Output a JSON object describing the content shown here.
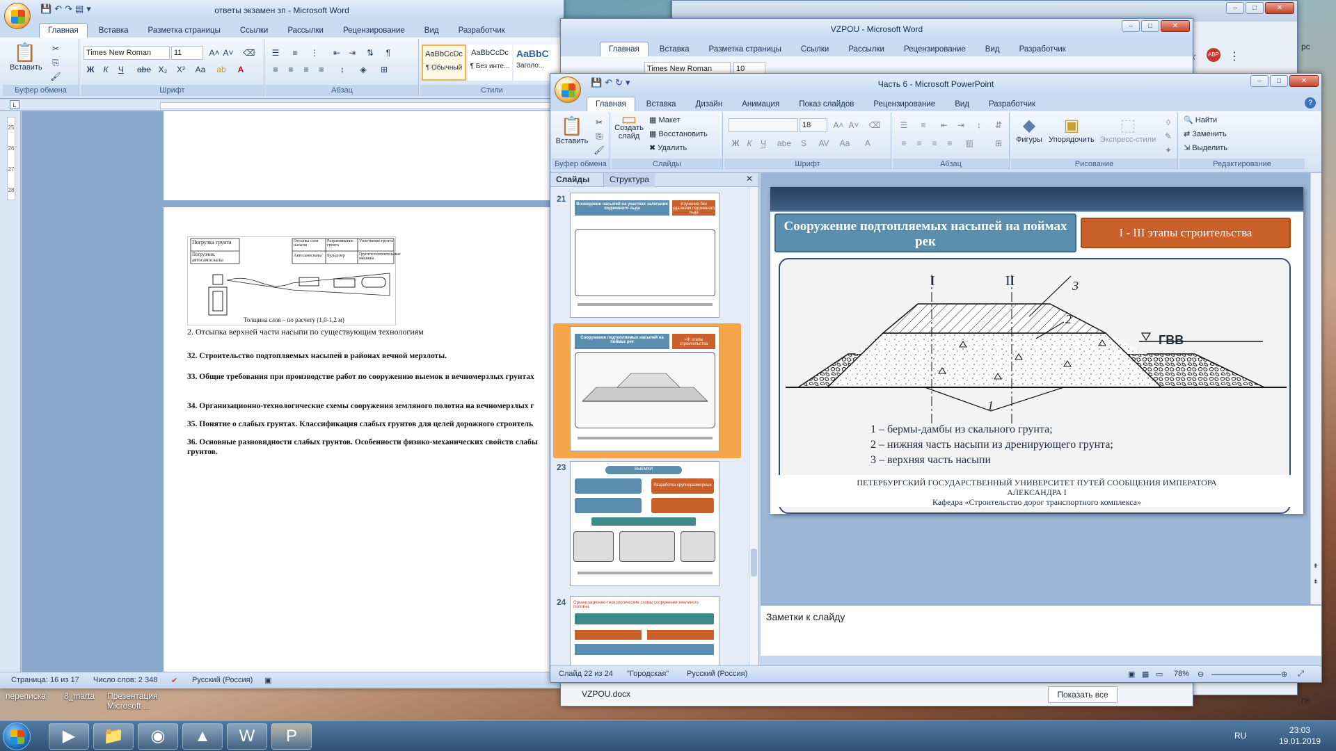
{
  "desktop": {
    "items": [
      {
        "label": "переписка"
      },
      {
        "label": "8_marta"
      },
      {
        "label": "Презентация"
      },
      {
        "label": "Microsoft ..."
      }
    ],
    "partial_texts": [
      "рс",
      "ne"
    ]
  },
  "word_main": {
    "title": "ответы экзамен зп - Microsoft Word",
    "tabs": [
      "Главная",
      "Вставка",
      "Разметка страницы",
      "Ссылки",
      "Рассылки",
      "Рецензирование",
      "Вид",
      "Разработчик"
    ],
    "groups": {
      "clipboard": "Буфер обмена",
      "font": "Шрифт",
      "paragraph": "Абзац",
      "styles": "Стили"
    },
    "paste_label": "Вставить",
    "font_name": "Times New Roman",
    "font_size": "11",
    "format_buttons": [
      "Ж",
      "К",
      "Ч",
      "abe",
      "X₂",
      "X²",
      "Aa"
    ],
    "styles": [
      {
        "preview": "AaBbCcDc",
        "name": "¶ Обычный"
      },
      {
        "preview": "AaBbCcDc",
        "name": "¶ Без инте..."
      },
      {
        "preview": "AaBbC",
        "name": "Заголо..."
      }
    ],
    "ruler_marks": [
      "25",
      "26",
      "27",
      "28"
    ],
    "doc": {
      "figure": {
        "left_table": [
          [
            "Погрузка",
            "грунта"
          ],
          [
            "Погрузчик,",
            "автосамосвалы"
          ]
        ],
        "right_table": {
          "headers": [
            "Отсыпка слоя насыпи",
            "Разравнивание грунта",
            "Уплотнение грунта"
          ],
          "values": [
            "Автосамосвалы",
            "Бульдозер",
            "Грунтоуплотнительные машины"
          ]
        },
        "caption": "Толщина слоя – по расчету (1,0-1,2 м)"
      },
      "lines": [
        "2. Отсыпка верхней части насыпи по существующим технологиям",
        "32. Строительство подтопляемых насыпей в районах вечной мерзлоты.",
        "33. Общие требования при производстве работ по сооружению выемок в вечномерзлых грунтах",
        "34. Организационно-технологические схемы сооружения земляного полотна на вечномерзлых г",
        "35. Понятие о слабых грунтах. Классификация слабых грунтов для целей дорожного строитель",
        "36. Основные разновидности слабых грунтов. Особенности физико-механических свойств слабы",
        "грунтов."
      ]
    },
    "status": {
      "page": "Страница: 16 из 17",
      "words": "Число слов: 2 348",
      "lang": "Русский (Россия)"
    }
  },
  "word_vzpou": {
    "title": "VZPOU - Microsoft Word",
    "tabs": [
      "Главная",
      "Вставка",
      "Разметка страницы",
      "Ссылки",
      "Рассылки",
      "Рецензирование",
      "Вид",
      "Разработчик"
    ],
    "font_name": "Times New Roman",
    "font_size": "10",
    "download": {
      "file": "VZPOU.docx",
      "show_all": "Показать все"
    }
  },
  "ppt": {
    "title": "Часть 6 - Microsoft PowerPoint",
    "tabs": [
      "Главная",
      "Вставка",
      "Дизайн",
      "Анимация",
      "Показ слайдов",
      "Рецензирование",
      "Вид",
      "Разработчик"
    ],
    "ribbon": {
      "paste": "Вставить",
      "create_slide": "Создать слайд",
      "layout": "Макет",
      "reset": "Восстановить",
      "delete": "Удалить",
      "font_size": "18",
      "shapes": "Фигуры",
      "arrange": "Упорядочить",
      "quick_styles": "Экспресс-стили",
      "find": "Найти",
      "replace": "Заменить",
      "select": "Выделить",
      "groups": [
        "Буфер обмена",
        "Слайды",
        "Шрифт",
        "Абзац",
        "Рисование",
        "Редактирование"
      ]
    },
    "panel_tabs": [
      "Слайды",
      "Структура"
    ],
    "thumbnails": [
      {
        "num": "21",
        "title": "Возведение насыпей на участках залегания подземного льда",
        "badge": "Изучение без удаления подземного льда"
      },
      {
        "num": "22",
        "title": "Сооружение подтопляемых насыпей на поймах рек",
        "badge": "I-III этапы строительства"
      },
      {
        "num": "23",
        "title": "ВЫЕМКИ",
        "badge": "Разработка крупноразмерных"
      },
      {
        "num": "24",
        "title": "Организационно-технологические схемы сооружения земляного полотна",
        "badge": ""
      }
    ],
    "slide": {
      "title": "Сооружение подтопляемых насыпей на поймах рек",
      "badge": "I - III этапы строительства",
      "diagram_labels": {
        "axis1": "I",
        "axis2": "II",
        "n1": "1",
        "n2": "2",
        "n3": "3",
        "water": "ГВВ"
      },
      "legend": [
        "1 – бермы-дамбы из скального грунта;",
        "2 – нижняя часть насыпи из дренирующего грунта;",
        "3 – верхняя часть насыпи"
      ],
      "footer": [
        "ПЕТЕРБУРГСКИЙ ГОСУДАРСТВЕННЫЙ УНИВЕРСИТЕТ ПУТЕЙ СООБЩЕНИЯ ИМПЕРАТОРА",
        "АЛЕКСАНДРА I",
        "Кафедра «Строительство дорог транспортного комплекса»"
      ]
    },
    "notes_placeholder": "Заметки к слайду",
    "status": {
      "slide": "Слайд 22 из 24",
      "theme": "\"Городская\"",
      "lang": "Русский (Россия)",
      "zoom": "78%"
    }
  },
  "taskbar": {
    "lang": "RU",
    "time": "23:03",
    "date": "19.01.2019"
  },
  "colors": {
    "slide_title_bg": "#5a8dae",
    "slide_badge_bg": "#c9602a",
    "thumb_selected": "#f5a54a",
    "ribbon_blue": "#c4d7ee"
  }
}
